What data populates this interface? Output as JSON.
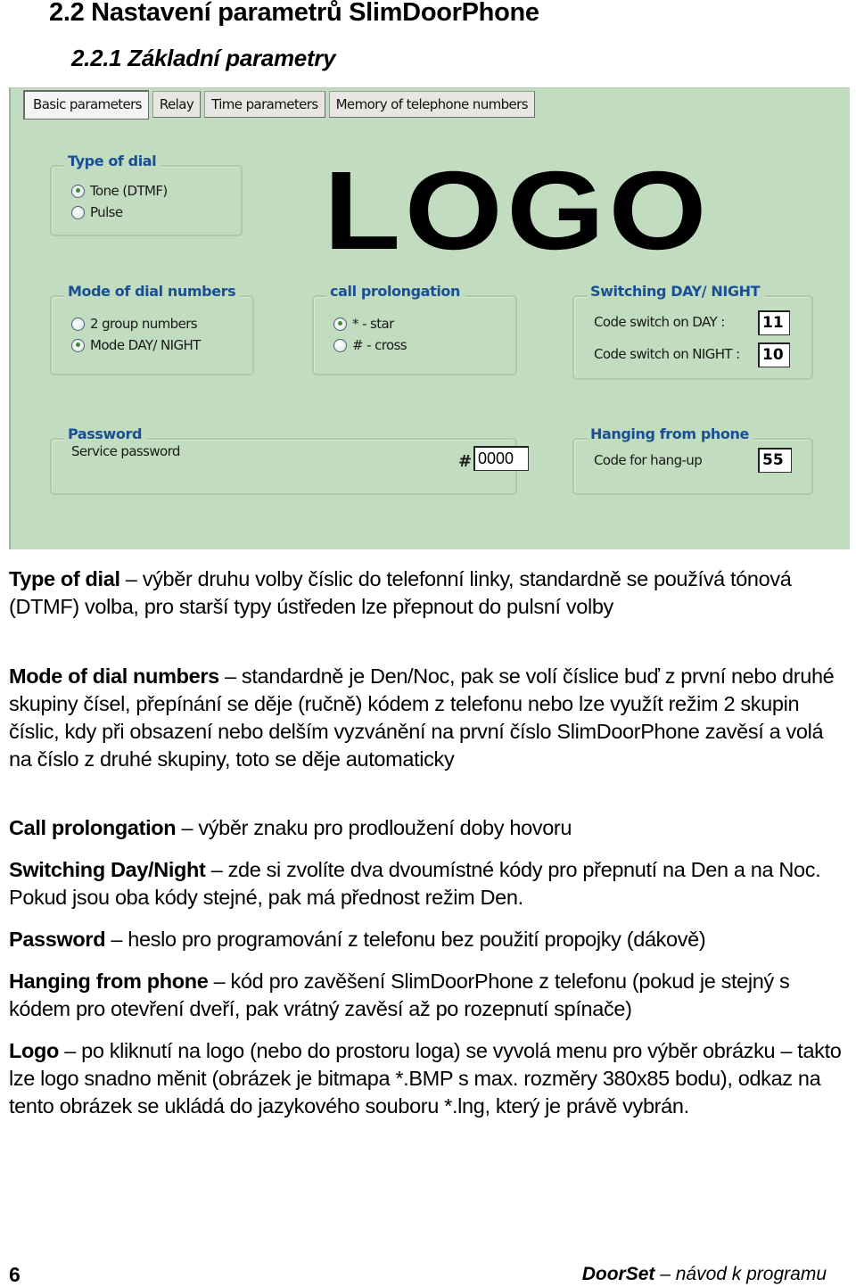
{
  "heading": {
    "section": "2.2  Nastavení parametrů SlimDoorPhone",
    "subsection": "2.2.1 Základní parametry"
  },
  "app": {
    "tabs": [
      {
        "label": "Basic parameters",
        "active": true
      },
      {
        "label": "Relay",
        "active": false
      },
      {
        "label": "Time parameters",
        "active": false
      },
      {
        "label": "Memory of telephone numbers",
        "active": false
      }
    ],
    "logo_text": "LOGO",
    "type_of_dial": {
      "title": "Type of dial",
      "options": [
        {
          "label": "Tone (DTMF)",
          "selected": true
        },
        {
          "label": "Pulse",
          "selected": false
        }
      ]
    },
    "mode_of_dial_numbers": {
      "title": "Mode of dial numbers",
      "options": [
        {
          "label": "2 group numbers",
          "selected": false
        },
        {
          "label": "Mode DAY/ NIGHT",
          "selected": true
        }
      ]
    },
    "call_prolongation": {
      "title": "call prolongation",
      "options": [
        {
          "label": "*  - star",
          "selected": true
        },
        {
          "label": "#  - cross",
          "selected": false
        }
      ]
    },
    "switching": {
      "title": "Switching DAY/ NIGHT",
      "day_label": "Code switch on DAY :",
      "day_value": "11",
      "night_label": "Code switch on NIGHT :",
      "night_value": "10"
    },
    "password": {
      "title": "Password",
      "label": "Service password",
      "prefix": "#",
      "value": "0000"
    },
    "hanging": {
      "title": "Hanging from phone",
      "label": "Code for hang-up",
      "value": "55"
    }
  },
  "paragraphs": [
    {
      "term": "Type of dial",
      "text": " – výběr druhu volby číslic do telefonní linky, standardně se používá tónová (DTMF) volba, pro starší typy ústředen lze přepnout do pulsní volby"
    },
    {
      "term": "Mode of dial numbers",
      "text": " – standardně je Den/Noc, pak se volí číslice buď z první nebo druhé skupiny čísel, přepínání se děje (ručně) kódem z telefonu nebo lze využít režim 2 skupin číslic, kdy při obsazení nebo delším vyzvánění na první číslo SlimDoorPhone zavěsí a volá na číslo z druhé skupiny, toto se děje automaticky"
    },
    {
      "term": "Call prolongation",
      "text": " – výběr znaku pro prodloužení doby hovoru"
    },
    {
      "term": "Switching Day/Night",
      "text": " – zde si zvolíte dva dvoumístné kódy pro přepnutí na Den a na Noc. Pokud jsou oba kódy stejné, pak má přednost režim Den."
    },
    {
      "term": "Password",
      "text": " – heslo pro programování z telefonu bez použití propojky (dákově)"
    },
    {
      "term": "Hanging from phone",
      "text": " – kód pro zavěšení SlimDoorPhone z telefonu (pokud je stejný s kódem pro otevření dveří, pak vrátný zavěsí až po rozepnutí spínače)"
    },
    {
      "term": "Logo",
      "text": " – po kliknutí na logo (nebo do prostoru loga) se vyvolá menu pro výběr obrázku – takto lze logo snadno měnit (obrázek je bitmapa *.BMP s max. rozměry 380x85 bodu), odkaz na tento obrázek se ukládá do jazykového souboru *.lng, který je právě vybrán."
    }
  ],
  "footer": {
    "page_number": "6",
    "product": "DoorSet",
    "subtitle": " – návod k programu"
  }
}
